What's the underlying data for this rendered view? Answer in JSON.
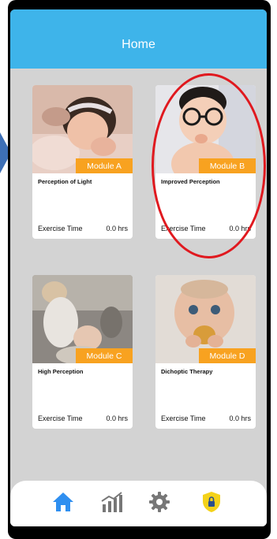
{
  "header": {
    "title": "Home"
  },
  "modules": [
    {
      "tag": "Module A",
      "title": "Perception of Light",
      "exercise_label": "Exercise Time",
      "exercise_value": "0.0 hrs"
    },
    {
      "tag": "Module B",
      "title": "Improved Perception",
      "exercise_label": "Exercise Time",
      "exercise_value": "0.0 hrs"
    },
    {
      "tag": "Module C",
      "title": "High Perception",
      "exercise_label": "Exercise Time",
      "exercise_value": "0.0 hrs"
    },
    {
      "tag": "Module D",
      "title": "Dichoptic Therapy",
      "exercise_label": "Exercise Time",
      "exercise_value": "0.0 hrs"
    }
  ],
  "nav": [
    {
      "icon": "home-icon"
    },
    {
      "icon": "chart-icon"
    },
    {
      "icon": "gear-icon"
    },
    {
      "icon": "shield-lock-icon"
    }
  ],
  "colors": {
    "header": "#3eb4ea",
    "module_tag": "#f8a220",
    "active_nav": "#2f8ff0",
    "inactive_nav": "#777777",
    "highlight": "#e0191f"
  }
}
